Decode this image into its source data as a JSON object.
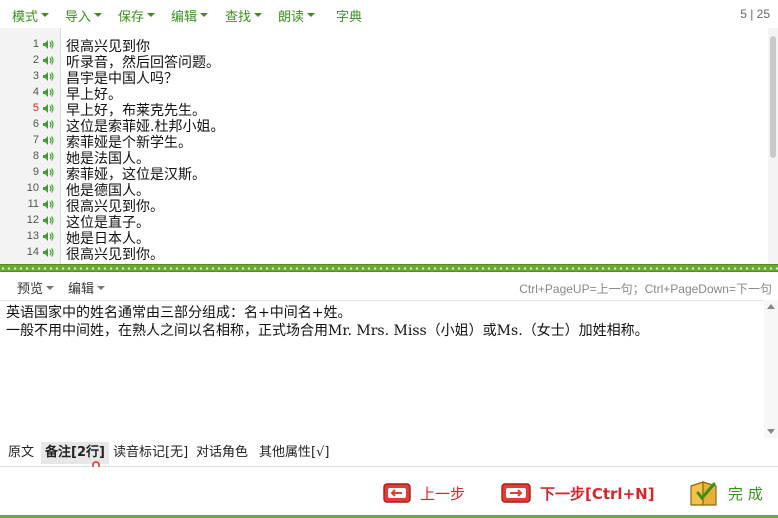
{
  "menubar": {
    "items": [
      {
        "label": "模式",
        "has_caret": true
      },
      {
        "label": "导入",
        "has_caret": true
      },
      {
        "label": "保存",
        "has_caret": true
      },
      {
        "label": "编辑",
        "has_caret": true
      },
      {
        "label": "查找",
        "has_caret": true
      },
      {
        "label": "朗读",
        "has_caret": true
      },
      {
        "label": "字典",
        "has_caret": false
      }
    ],
    "page_indicator": "5 | 25"
  },
  "editor": {
    "active_line": 5,
    "lines": [
      {
        "num": "1",
        "text": "很高兴见到你"
      },
      {
        "num": "2",
        "text": "听录音，然后回答问题。"
      },
      {
        "num": "3",
        "text": "昌宇是中国人吗？"
      },
      {
        "num": "4",
        "text": "早上好。"
      },
      {
        "num": "5",
        "text": "早上好，布莱克先生。"
      },
      {
        "num": "6",
        "text": "这位是索菲娅.杜邦小姐。"
      },
      {
        "num": "7",
        "text": "索菲娅是个新学生。"
      },
      {
        "num": "8",
        "text": "她是法国人。"
      },
      {
        "num": "9",
        "text": "索菲娅，这位是汉斯。"
      },
      {
        "num": "10",
        "text": "他是德国人。"
      },
      {
        "num": "11",
        "text": "很高兴见到你。"
      },
      {
        "num": "12",
        "text": "这位是直子。"
      },
      {
        "num": "13",
        "text": "她是日本人。"
      },
      {
        "num": "14",
        "text": "很高兴见到你。"
      }
    ]
  },
  "subbar": {
    "preview_label": "预览",
    "edit_label": "编辑",
    "hint": "Ctrl+PageUP=上一句；Ctrl+PageDown=下一句"
  },
  "notes": {
    "line1": "英语国家中的姓名通常由三部分组成：名+中间名+姓。",
    "line2": "一般不用中间姓，在熟人之间以名相称，正式场合用Mr. Mrs. Miss（小姐）或Ms.（女士）加姓相称。"
  },
  "tabs": [
    {
      "label": "原文",
      "active": false
    },
    {
      "label": "备注[2行]",
      "active": true
    },
    {
      "label": "读音标记[无]",
      "active": false
    },
    {
      "label": "对话角色",
      "active": false
    },
    {
      "label": "其他属性[√]",
      "active": false
    }
  ],
  "footer": {
    "prev_label": "上一步",
    "next_label": "下一步[Ctrl+N]",
    "done_label": "完 成"
  },
  "colors": {
    "accent_green": "#3a8f1c",
    "splitter_green": "#6aaa34",
    "button_red": "#d9262a",
    "active_line_number": "#dd2222"
  }
}
